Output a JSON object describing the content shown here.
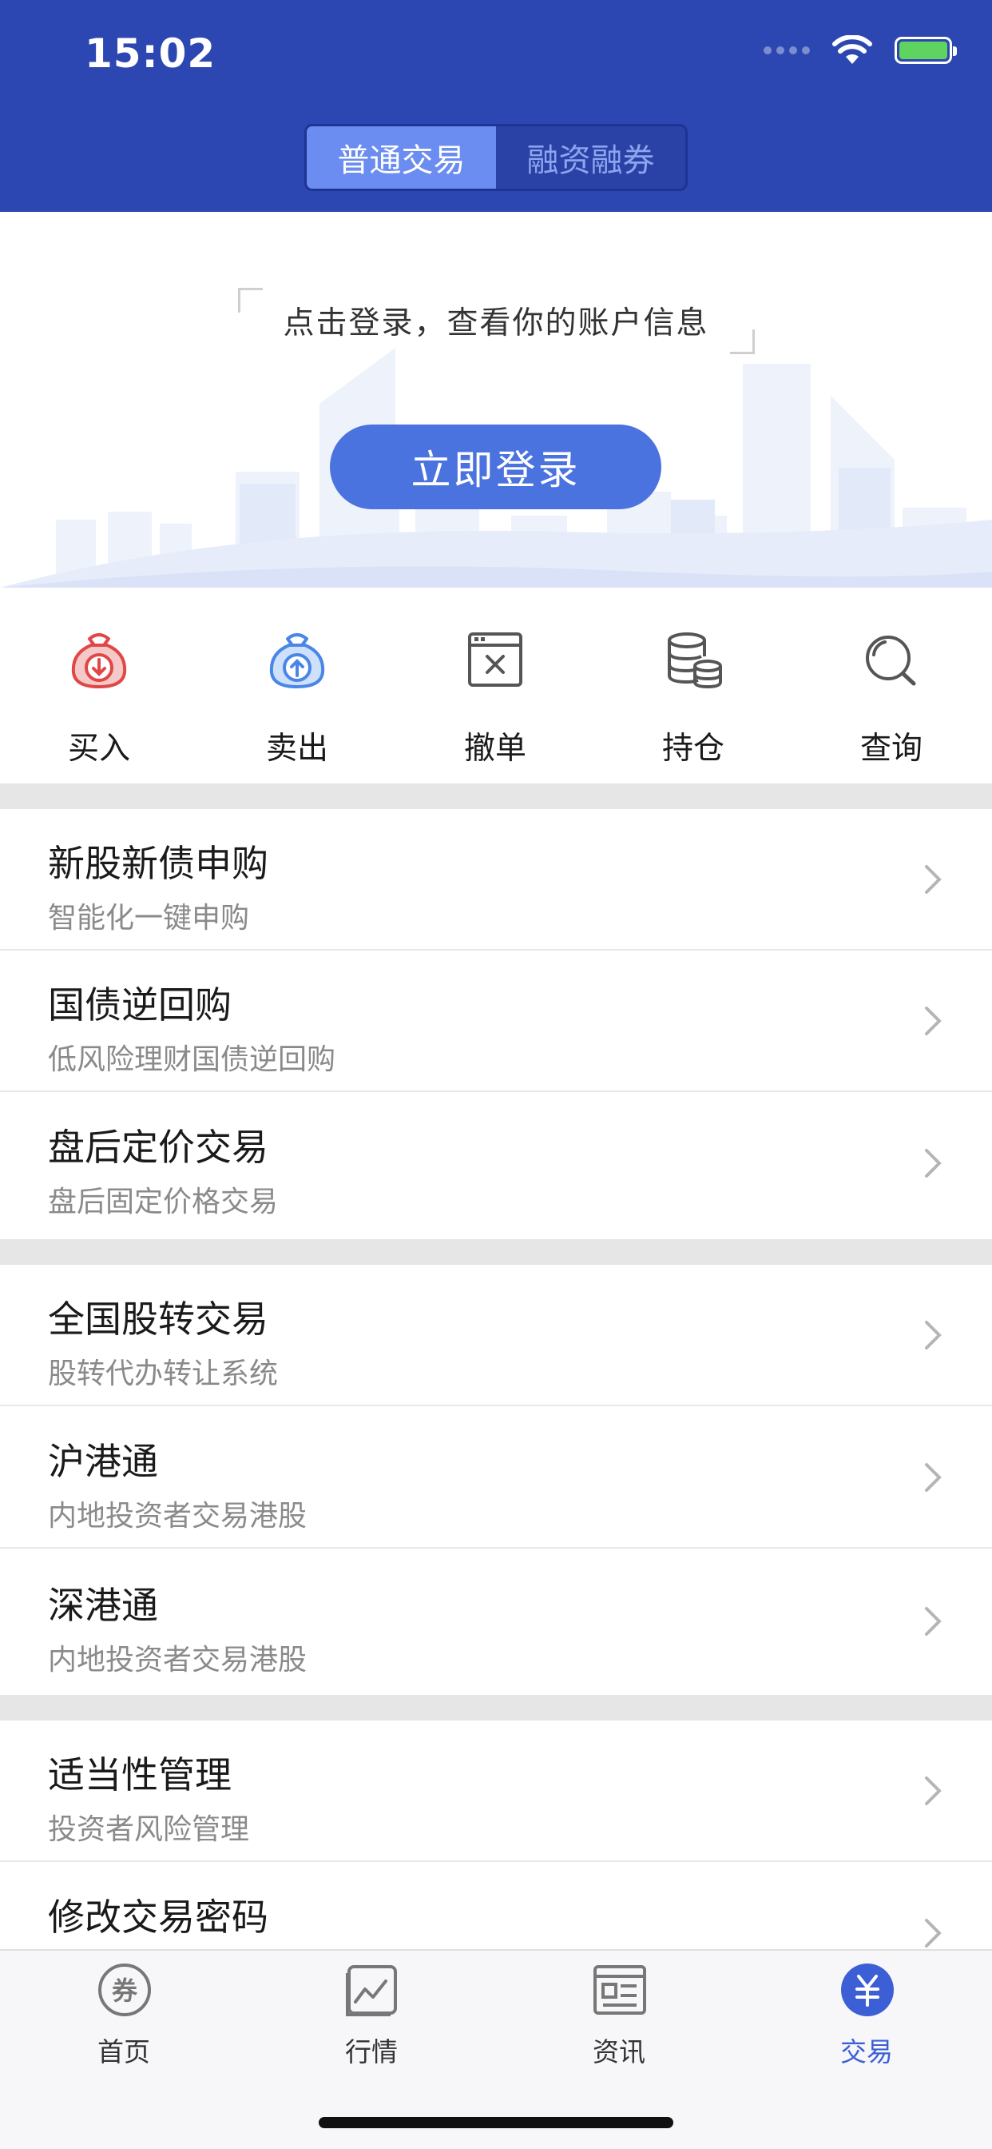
{
  "status_bar": {
    "time": "15:02"
  },
  "segments": [
    {
      "label": "普通交易",
      "active": true
    },
    {
      "label": "融资融券",
      "active": false
    }
  ],
  "login": {
    "prompt": "点击登录，查看你的账户信息",
    "button_label": "立即登录"
  },
  "actions": [
    {
      "label": "买入",
      "icon": "buy-bag-icon"
    },
    {
      "label": "卖出",
      "icon": "sell-bag-icon"
    },
    {
      "label": "撤单",
      "icon": "cancel-order-icon"
    },
    {
      "label": "持仓",
      "icon": "holdings-icon"
    },
    {
      "label": "查询",
      "icon": "search-icon"
    }
  ],
  "menu_groups": [
    [
      {
        "title": "新股新债申购",
        "subtitle": "智能化一键申购"
      },
      {
        "title": "国债逆回购",
        "subtitle": "低风险理财国债逆回购"
      },
      {
        "title": "盘后定价交易",
        "subtitle": "盘后固定价格交易"
      }
    ],
    [
      {
        "title": "全国股转交易",
        "subtitle": "股转代办转让系统"
      },
      {
        "title": "沪港通",
        "subtitle": "内地投资者交易港股"
      },
      {
        "title": "深港通",
        "subtitle": "内地投资者交易港股"
      }
    ],
    [
      {
        "title": "适当性管理",
        "subtitle": "投资者风险管理"
      },
      {
        "title": "修改交易密码",
        "subtitle": ""
      }
    ]
  ],
  "tabbar": [
    {
      "label": "首页",
      "icon": "coupon-icon",
      "active": false
    },
    {
      "label": "行情",
      "icon": "chart-icon",
      "active": false
    },
    {
      "label": "资讯",
      "icon": "news-icon",
      "active": false
    },
    {
      "label": "交易",
      "icon": "yuan-icon",
      "active": true
    }
  ],
  "colors": {
    "header": "#2c47b1",
    "accent": "#4b73e0",
    "buy": "#e04848",
    "sell": "#4a86e8"
  }
}
